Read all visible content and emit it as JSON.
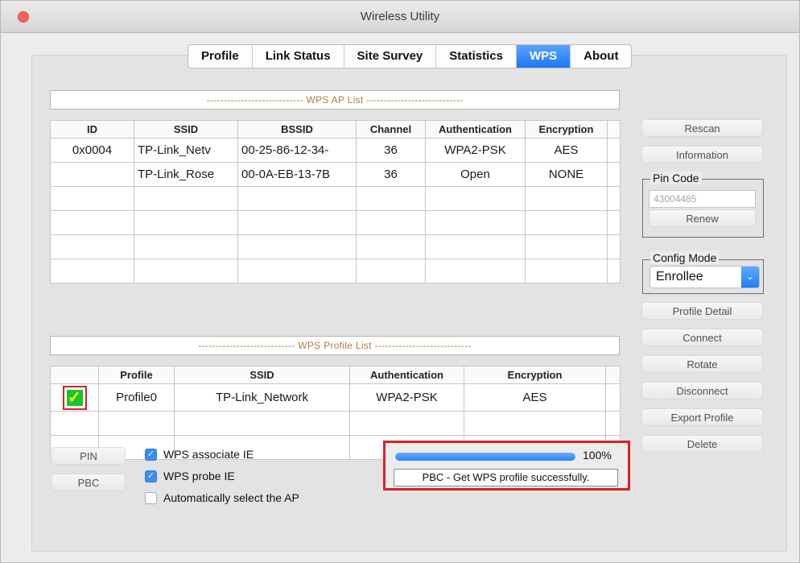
{
  "window": {
    "title": "Wireless Utility"
  },
  "tabs": [
    {
      "label": "Profile",
      "active": false
    },
    {
      "label": "Link Status",
      "active": false
    },
    {
      "label": "Site Survey",
      "active": false
    },
    {
      "label": "Statistics",
      "active": false
    },
    {
      "label": "WPS",
      "active": true
    },
    {
      "label": "About",
      "active": false
    }
  ],
  "ap_list": {
    "title": "---------------------------- WPS AP List ----------------------------",
    "headers": [
      "ID",
      "SSID",
      "BSSID",
      "Channel",
      "Authentication",
      "Encryption"
    ],
    "rows": [
      [
        "0x0004",
        "TP-Link_Netv",
        "00-25-86-12-34-",
        "36",
        "WPA2-PSK",
        "AES"
      ],
      [
        "",
        "TP-Link_Rose",
        "00-0A-EB-13-7B",
        "36",
        "Open",
        "NONE"
      ]
    ]
  },
  "profile_list": {
    "title": "---------------------------- WPS Profile List ----------------------------",
    "headers": [
      "",
      "Profile",
      "SSID",
      "Authentication",
      "Encryption"
    ],
    "rows": [
      {
        "checked": true,
        "profile": "Profile0",
        "ssid": "TP-Link_Network",
        "auth": "WPA2-PSK",
        "enc": "AES"
      }
    ]
  },
  "right_panel": {
    "rescan": "Rescan",
    "information": "Information",
    "pin_code_legend": "Pin Code",
    "pin_code_value": "43004485",
    "renew": "Renew",
    "config_mode_legend": "Config Mode",
    "config_mode_value": "Enrollee",
    "profile_detail": "Profile Detail",
    "connect": "Connect",
    "rotate": "Rotate",
    "disconnect": "Disconnect",
    "export_profile": "Export Profile",
    "delete": "Delete"
  },
  "bottom": {
    "pin_button": "PIN",
    "pbc_button": "PBC",
    "wps_associate_ie": {
      "label": "WPS associate IE",
      "checked": true
    },
    "wps_probe_ie": {
      "label": "WPS probe IE",
      "checked": true
    },
    "auto_select_ap": {
      "label": "Automatically select the AP",
      "checked": false
    },
    "progress_value": 1.0,
    "progress_text": "100%",
    "status_message": "PBC - Get WPS profile successfully."
  },
  "colors": {
    "accent": "#1d79f2",
    "highlight_border": "#d92128",
    "section_title": "#b27f3a",
    "check_green": "#1bc42a"
  }
}
